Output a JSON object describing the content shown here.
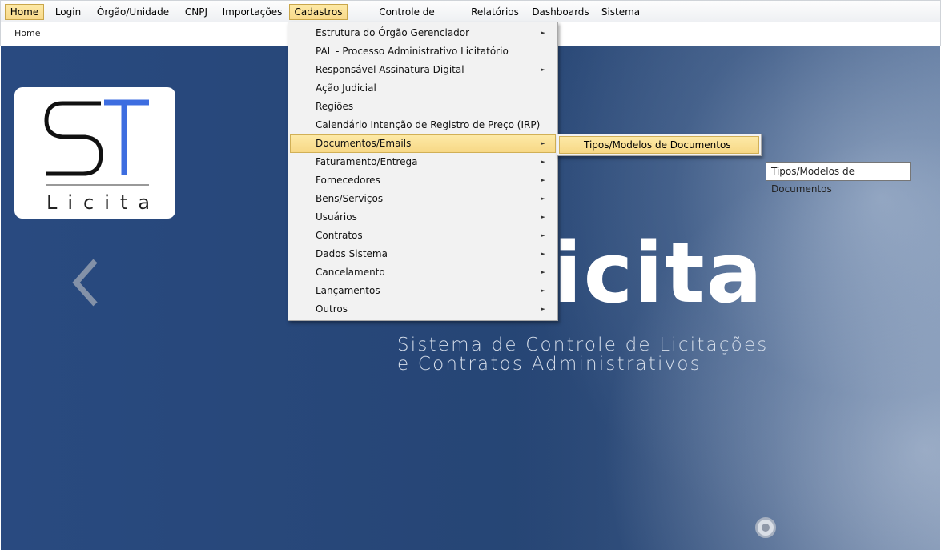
{
  "menubar": {
    "items": [
      {
        "label": "Home"
      },
      {
        "label": "Login"
      },
      {
        "label": "Órgão/Unidade"
      },
      {
        "label": "CNPJ"
      },
      {
        "label": "Importações"
      },
      {
        "label": "Cadastros"
      },
      {
        "label": "Controle de Execuções"
      },
      {
        "label": "Relatórios"
      },
      {
        "label": "Dashboards"
      },
      {
        "label": "Sistema"
      }
    ],
    "active": "Cadastros"
  },
  "breadcrumb": {
    "current": "Home"
  },
  "banner": {
    "logo": {
      "letters": "ST",
      "subtitle": "Licita"
    },
    "headline": "icita",
    "tagline_line1": "Sistema de Controle de Licitações",
    "tagline_line2": "e Contratos Administrativos",
    "prev_icon": "chevron-left-icon",
    "indicator_icon": "carousel-dot-icon"
  },
  "dropdown": {
    "items": [
      {
        "label": "Estrutura do Órgão Gerenciador",
        "has_submenu": true
      },
      {
        "label": "PAL - Processo Administrativo Licitatório",
        "has_submenu": false
      },
      {
        "label": "Responsável Assinatura Digital",
        "has_submenu": true
      },
      {
        "label": "Ação Judicial",
        "has_submenu": false
      },
      {
        "label": "Regiões",
        "has_submenu": false
      },
      {
        "label": "Calendário Intenção de Registro de Preço (IRP)",
        "has_submenu": false
      },
      {
        "label": "Documentos/Emails",
        "has_submenu": true
      },
      {
        "label": "Faturamento/Entrega",
        "has_submenu": true
      },
      {
        "label": "Fornecedores",
        "has_submenu": true
      },
      {
        "label": "Bens/Serviços",
        "has_submenu": true
      },
      {
        "label": "Usuários",
        "has_submenu": true
      },
      {
        "label": "Contratos",
        "has_submenu": true
      },
      {
        "label": "Dados Sistema",
        "has_submenu": true
      },
      {
        "label": "Cancelamento",
        "has_submenu": true
      },
      {
        "label": "Lançamentos",
        "has_submenu": true
      },
      {
        "label": "Outros",
        "has_submenu": true
      }
    ],
    "active": "Documentos/Emails",
    "arrow_glyph": "►"
  },
  "submenu": {
    "items": [
      {
        "label": "Tipos/Modelos de Documentos"
      }
    ]
  },
  "tooltip": {
    "text": "Tipos/Modelos de Documentos"
  },
  "colors": {
    "highlight": "#f8d98a",
    "banner": "#264574",
    "logo_accent": "#3d6de0"
  }
}
